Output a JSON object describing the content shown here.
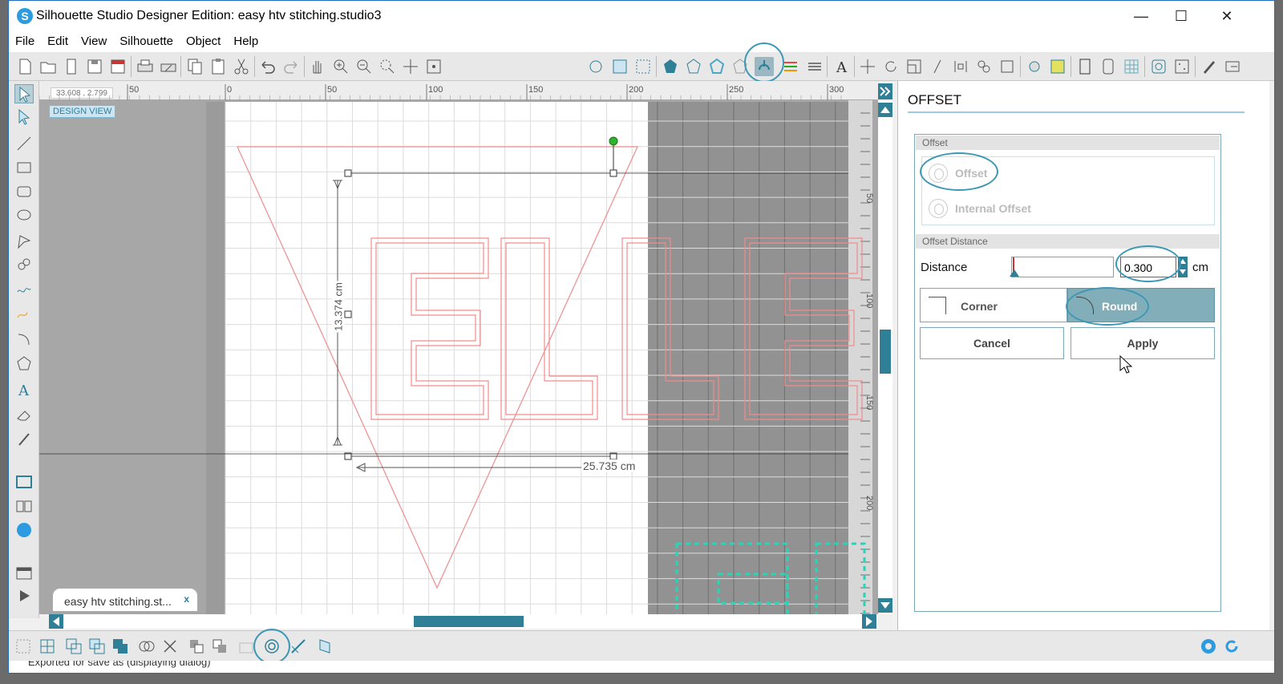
{
  "window": {
    "title": "Silhouette Studio Designer Edition: easy htv stitching.studio3",
    "app_icon_letter": "S",
    "controls": {
      "minimize": "—",
      "maximize": "☐",
      "close": "✕"
    }
  },
  "menu": [
    "File",
    "Edit",
    "View",
    "Silhouette",
    "Object",
    "Help"
  ],
  "canvas": {
    "coords": "33.608 , 2.799",
    "design_view_label": "DESIGN VIEW",
    "ruler_h_labels": [
      "50",
      "0",
      "50",
      "100",
      "150",
      "200",
      "250",
      "300"
    ],
    "ruler_v_labels": [
      "50",
      "100",
      "150",
      "200"
    ],
    "dim_height": "13.374 cm",
    "dim_width": "25.735 cm",
    "doc_tab": "easy htv stitching.st...",
    "doc_tab_close": "x",
    "art_text": "ELLE",
    "colors": {
      "outline": "#ef8c8c",
      "cut_dash": "#27d6b7",
      "accent": "#2f7f97"
    }
  },
  "panel": {
    "title": "OFFSET",
    "offset_section": "Offset",
    "options": [
      "Offset",
      "Internal Offset"
    ],
    "distance_section": "Offset Distance",
    "distance_label": "Distance",
    "distance_value": "0.300",
    "distance_unit": "cm",
    "corner_label": "Corner",
    "round_label": "Round",
    "cancel_label": "Cancel",
    "apply_label": "Apply"
  },
  "status_text": "Exported for save as (displaying dialog)"
}
